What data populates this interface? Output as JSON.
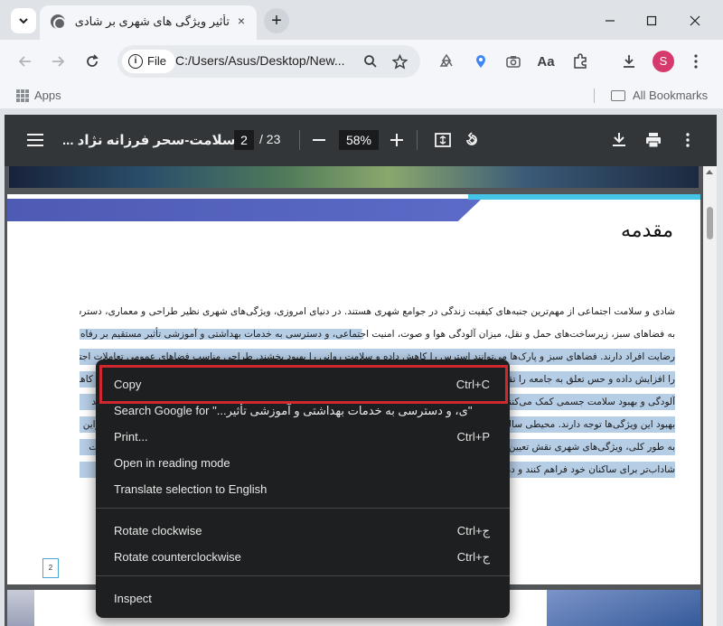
{
  "browser": {
    "tab_title": "تأثیر ویژگی های شهری بر شادی و",
    "tab_close": "×",
    "new_tab": "+",
    "omnibox": {
      "chip_label": "File",
      "url": "C:/Users/Asus/Desktop/New..."
    },
    "avatar_letter": "S",
    "bookmarks": {
      "apps_label": "Apps",
      "all_bookmarks_label": "All Bookmarks"
    }
  },
  "pdf_viewer": {
    "title": "... و سلامت-سحر فرزانه نژاد",
    "current_page": "2",
    "total_pages": "/ 23",
    "zoom": "58%"
  },
  "document": {
    "heading": "مقدمه",
    "lines": [
      "شادی و سلامت اجتماعی از مهم‌ترین جنبه‌های کیفیت زندگی در جوامع شهری هستند. در دنیای امروزی، ویژگی‌های شهری نظیر طراحی و معماری، دسترسی",
      "به فضاهای سبز، زیرساخت‌های حمل و نقل، میزان آلودگی هوا و صوت، امنیت اجتماعی، و دسترسی به خدمات بهداشتی و آموزشی تأثیر مستقیم بر رفاه و",
      "رضایت افراد دارند. فضاهای سبز و پارک‌ها می‌توانند استرس را کاهش داده و سلامت روانی را بهبود بخشند. طراحی مناسب فضاهای عمومی تعاملات اجتماعی",
      "را افزایش داده و حس تعلق به جامعه را تقویت می‌کند. همچنین زیرساخت‌های حمل و نقل عمومی کارآمد و دسترسی آسان به خدمات شهری موجب کاهش",
      "آلودگی و بهبود سلامت جسمی کمک می‌کنند. امنیت اجتماعی و کاهش جرم نیز نقش مهمی در ایجاد احساس آرامش و شادی ساکنان شهر ایفا می‌کنند",
      "بهبود این ویژگی‌ها توجه دارند. محیطی سالم و پایدار می‌تواند کیفیت زندگی شهروندان را افزایش دهد و به ایجاد جامعه‌ای شاد و سالم کمک کند. بنابراین برنامه‌ریزان",
      "به طور کلی، ویژگی‌های شهری نقش تعیین‌کننده‌ای در شادی و سلامت اجتماعی ساکنان دارند و توجه به آن‌ها برای ساختن شهرهایی بهتر ضروری است",
      "شاداب‌تر برای ساکنان خود فراهم کنند و در نتیجه سطح رضایت و سلامت عمومی جامعه را ارتقا دهند"
    ],
    "page_number": "2"
  },
  "context_menu": {
    "copy": {
      "label": "Copy",
      "shortcut": "Ctrl+C"
    },
    "search": {
      "label": "Search Google for \"...ی، و دسترسی به خدمات بهداشتی و آموزشی تأثیر\""
    },
    "print": {
      "label": "Print...",
      "shortcut": "Ctrl+P"
    },
    "reading_mode": {
      "label": "Open in reading mode"
    },
    "translate": {
      "label": "Translate selection to English"
    },
    "rotate_cw": {
      "label": "Rotate clockwise",
      "shortcut": "Ctrl+ج"
    },
    "rotate_ccw": {
      "label": "Rotate counterclockwise",
      "shortcut": "Ctrl+ج"
    },
    "inspect": {
      "label": "Inspect"
    }
  },
  "colors": {
    "highlight_border": "#d0282e",
    "selection": "#b6cde6",
    "menu_bg": "#1e1f20"
  }
}
